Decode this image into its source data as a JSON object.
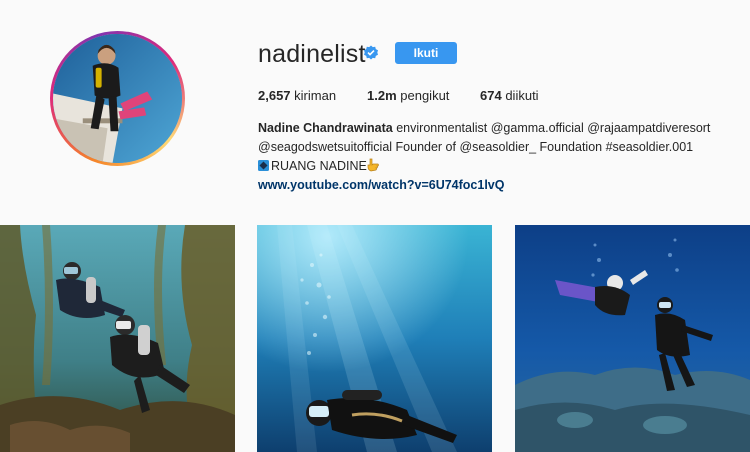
{
  "profile": {
    "username": "nadinelist",
    "follow_label": "Ikuti",
    "stats": {
      "posts_count": "2,657",
      "posts_label": "kiriman",
      "followers_count": "1.2m",
      "followers_label": "pengikut",
      "following_count": "674",
      "following_label": "diikuti"
    },
    "bio": {
      "full_name": "Nadine Chandrawinata",
      "line1": "environmentalist @gamma.official @rajaampatdiveresort",
      "line2": "@seagodswetsuitofficial Founder of @seasoldier_ Foundation #seasoldier.001",
      "line3": "RUANG NADINE",
      "link": "www.youtube.com/watch?v=6U74foc1lvQ"
    }
  },
  "colors": {
    "accent": "#3897f0",
    "link": "#003569",
    "background": "#fafafa"
  },
  "icons": [
    "verified-badge-icon",
    "diamond-icon",
    "pointing-hand-icon"
  ],
  "posts": [
    {
      "name": "post-kelp-divers"
    },
    {
      "name": "post-underwater-sunbeams"
    },
    {
      "name": "post-reef-divers"
    }
  ]
}
